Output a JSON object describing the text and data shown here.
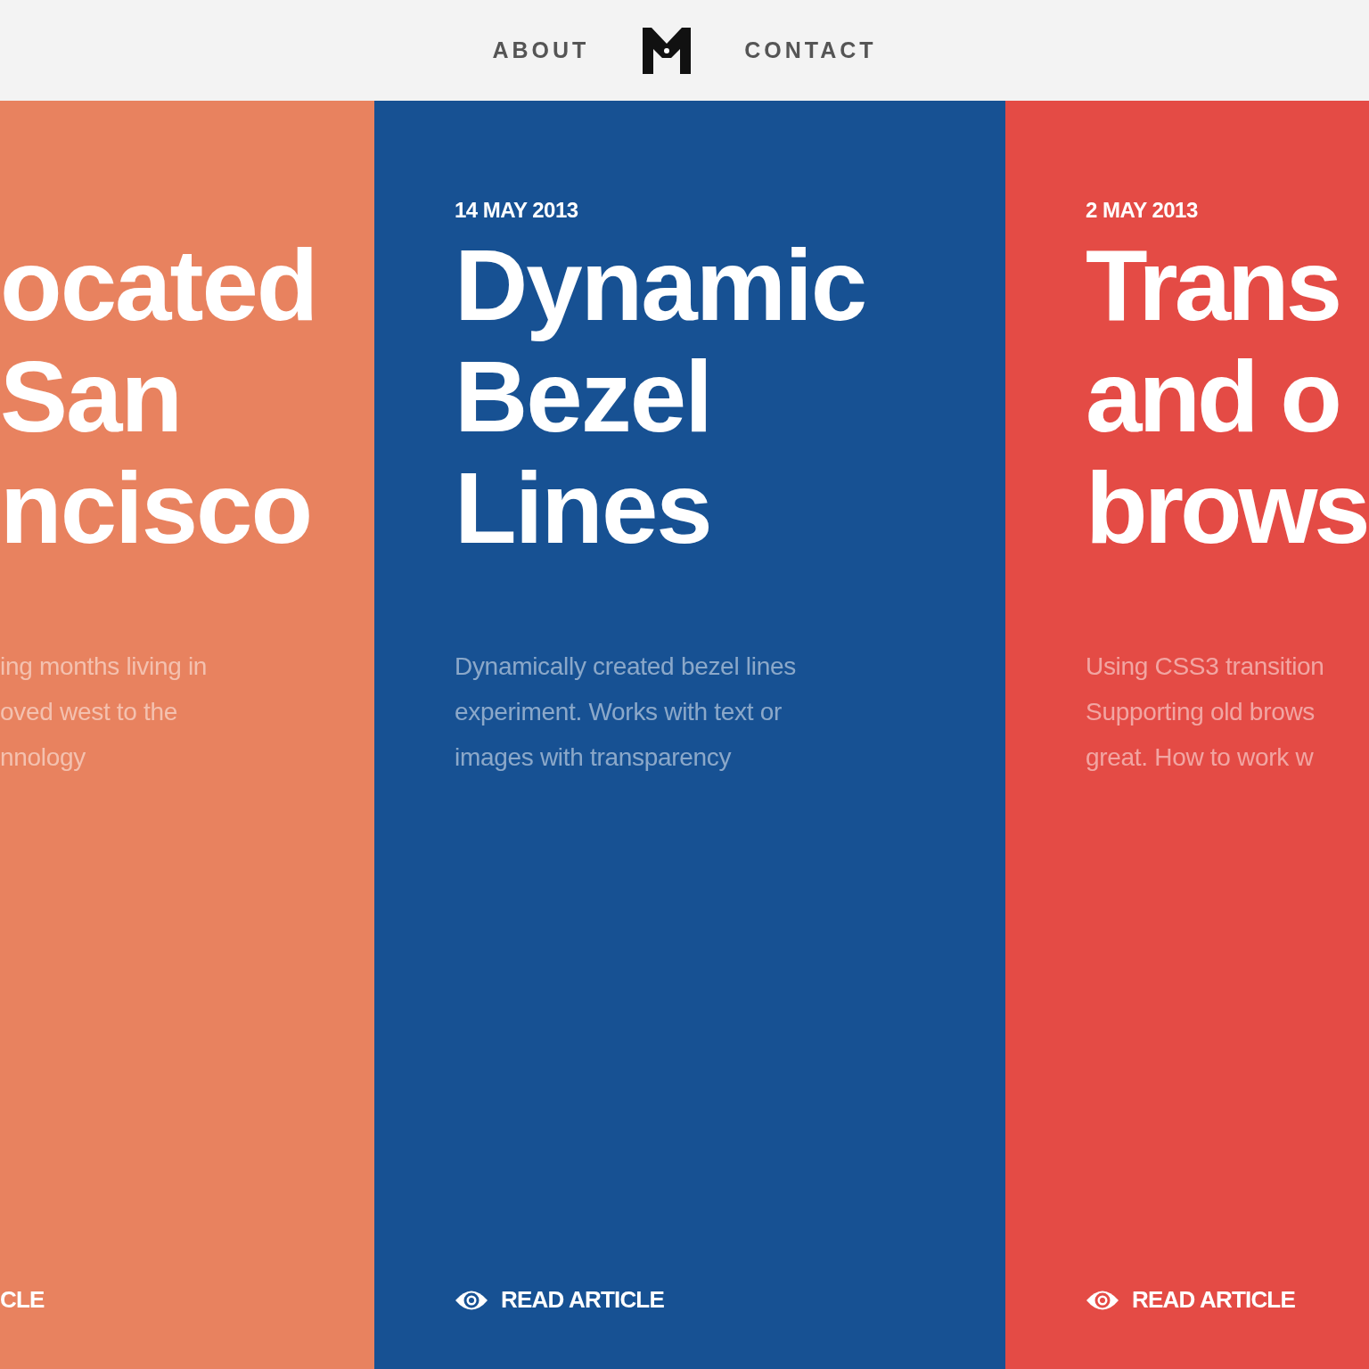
{
  "header": {
    "nav_left": "ABOUT",
    "nav_right": "CONTACT"
  },
  "articles": [
    {
      "color": "#e8825f",
      "title_lines": [
        "ocated",
        "San",
        "ncisco"
      ],
      "description_lines": [
        "ing months living in",
        "oved west to the",
        "nnology"
      ],
      "link": {
        "label": "CLE",
        "icon": false
      }
    },
    {
      "color": "#175193",
      "date": "14 MAY 2013",
      "title_lines": [
        "Dynamic",
        "Bezel",
        "Lines"
      ],
      "description_lines": [
        "Dynamically created bezel lines",
        "experiment. Works with text or",
        "images with transparency"
      ],
      "link": {
        "label": "READ ARTICLE",
        "icon": true
      }
    },
    {
      "color": "#e44b45",
      "date": "2 MAY 2013",
      "title_lines": [
        "Trans",
        "and o",
        "brows"
      ],
      "description_lines": [
        "Using CSS3 transition",
        "Supporting old brows",
        "great. How to work w"
      ],
      "link": {
        "label": "READ ARTICLE",
        "icon": true
      }
    }
  ]
}
